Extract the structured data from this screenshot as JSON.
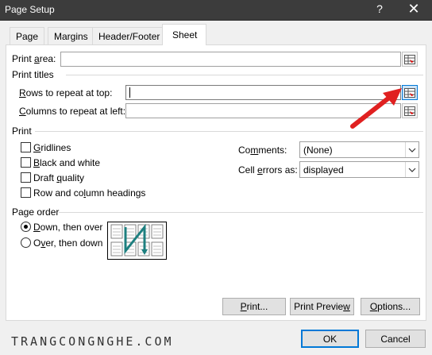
{
  "window": {
    "title": "Page Setup",
    "help_glyph": "?",
    "close_glyph": "✕"
  },
  "tabs": [
    {
      "label": "Page"
    },
    {
      "label": "Margins"
    },
    {
      "label": "Header/Footer"
    },
    {
      "label": "Sheet",
      "active": true
    }
  ],
  "print_area": {
    "label_pre": "Print ",
    "label_u": "a",
    "label_post": "rea:",
    "value": ""
  },
  "print_titles": {
    "heading": "Print titles",
    "rows": {
      "label_u": "R",
      "label_post": "ows to repeat at top:",
      "value": ""
    },
    "columns": {
      "label_u": "C",
      "label_post": "olumns to repeat at left:",
      "value": ""
    }
  },
  "print": {
    "heading": "Print",
    "gridlines": {
      "label_u": "G",
      "label_post": "ridlines",
      "checked": false
    },
    "black_white": {
      "label_u": "B",
      "label_post": "lack and white",
      "checked": false
    },
    "draft": {
      "label_pre": "Draft ",
      "label_u": "q",
      "label_post": "uality",
      "checked": false
    },
    "headings": {
      "label_pre": "Row and co",
      "label_u": "l",
      "label_post": "umn headings",
      "checked": false
    },
    "comments": {
      "label_pre": "Co",
      "label_u": "m",
      "label_post": "ments:",
      "value": "(None)"
    },
    "cell_errors": {
      "label_pre": "Cell ",
      "label_u": "e",
      "label_post": "rrors as:",
      "value": "displayed"
    }
  },
  "page_order": {
    "heading": "Page order",
    "down_over": {
      "label_u": "D",
      "label_post": "own, then over",
      "selected": true
    },
    "over_down": {
      "label_pre": "O",
      "label_u": "v",
      "label_post": "er, then down",
      "selected": false
    }
  },
  "buttons": {
    "print": {
      "label_u": "P",
      "label_post": "rint..."
    },
    "preview": {
      "label_pre": "Print Previe",
      "label_u": "w",
      "label_post": ""
    },
    "options": {
      "label_u": "O",
      "label_post": "ptions..."
    },
    "ok": "OK",
    "cancel": "Cancel"
  },
  "watermark": "TRANGCONGNGHE.COM",
  "colors": {
    "arrow": "#e02020",
    "highlight": "#cce4f7",
    "accent": "#0078d7"
  }
}
